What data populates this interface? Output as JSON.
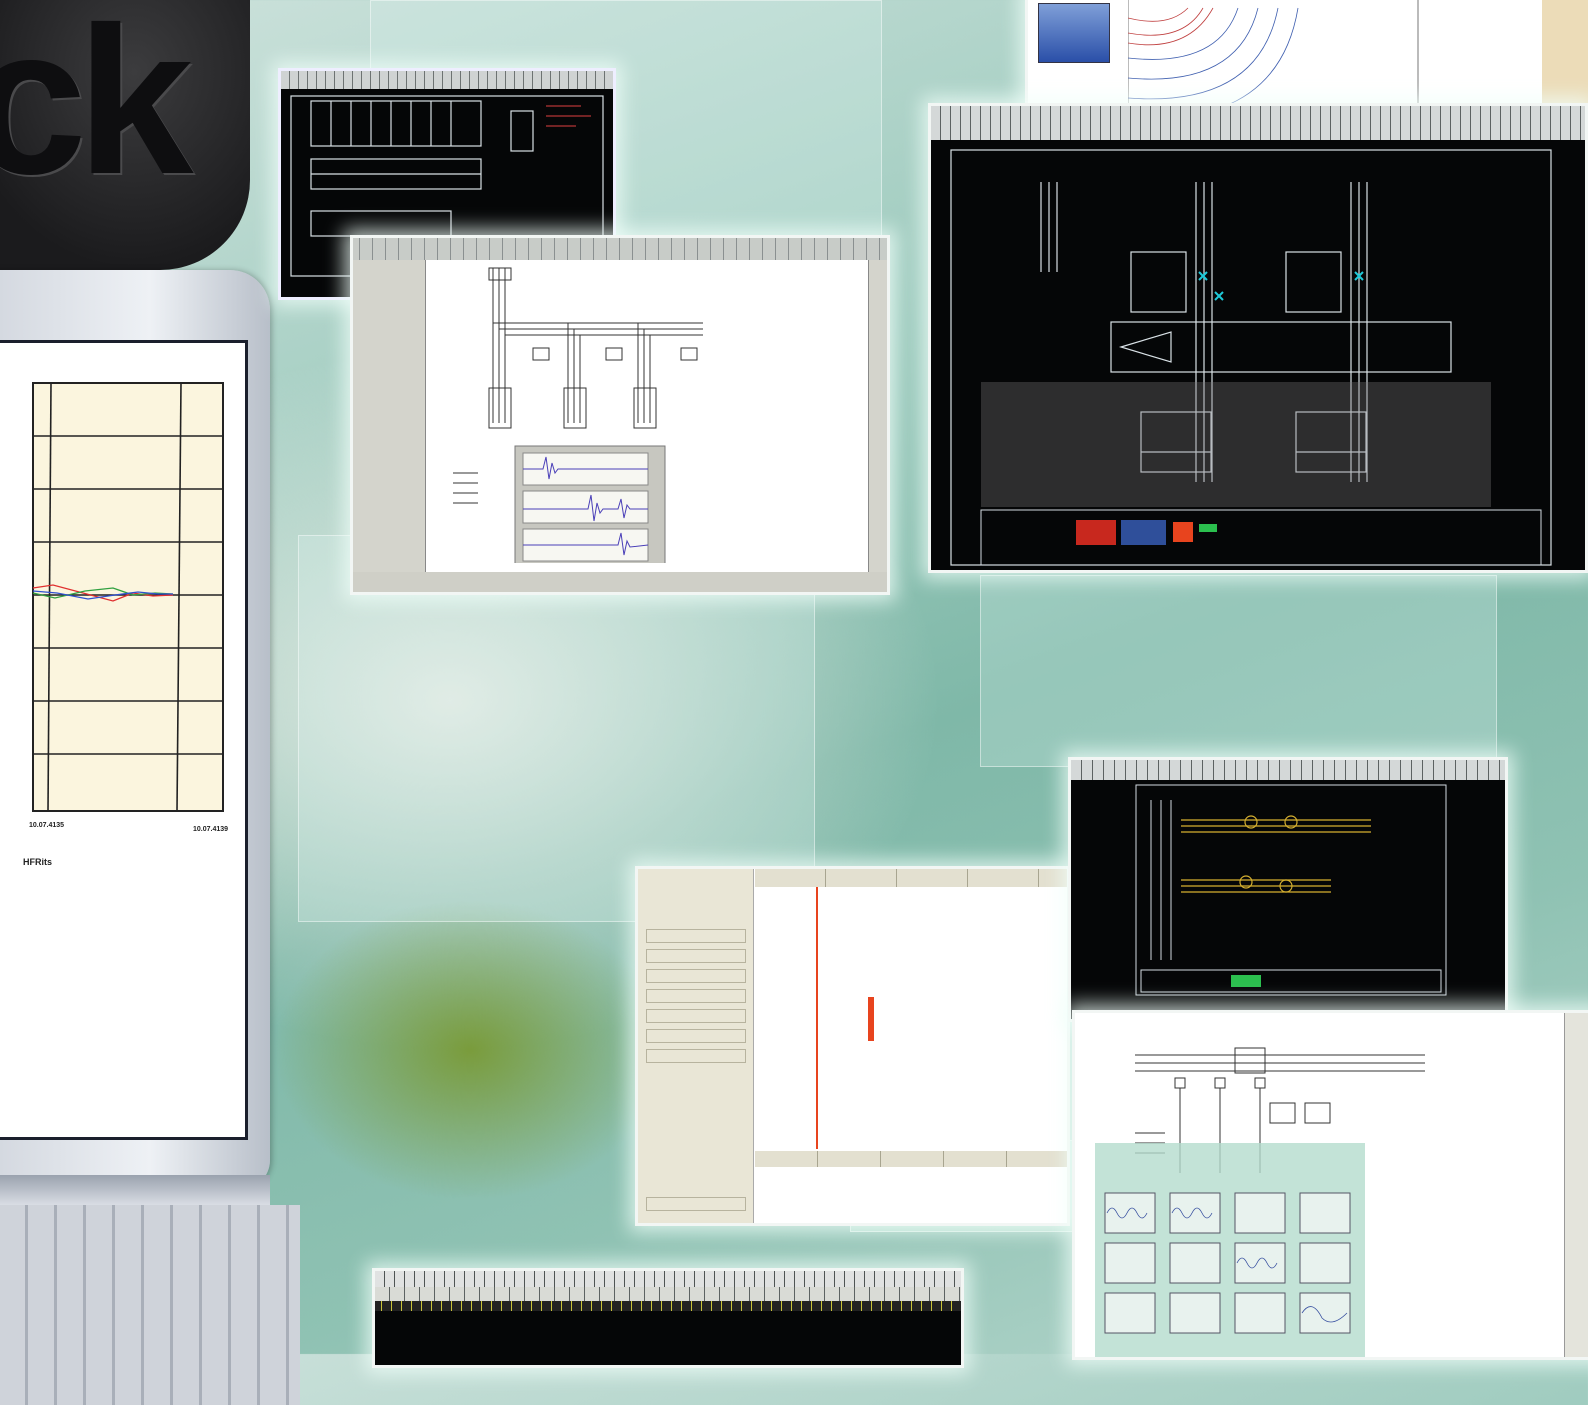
{
  "laptop": {
    "chart_text": {
      "x_tick_1": "10.07.4135",
      "x_tick_2": "10.07.4139",
      "legend_line_2": "HFRits"
    },
    "colors": {
      "chart_bg": "#fbf5de",
      "series_red": "#e03030",
      "series_green": "#30a040",
      "series_blue": "#3050d0"
    }
  },
  "colors": {
    "accent_red": "#e8441e",
    "cad_background": "#050607",
    "panel_glow": "#f0fffa"
  }
}
